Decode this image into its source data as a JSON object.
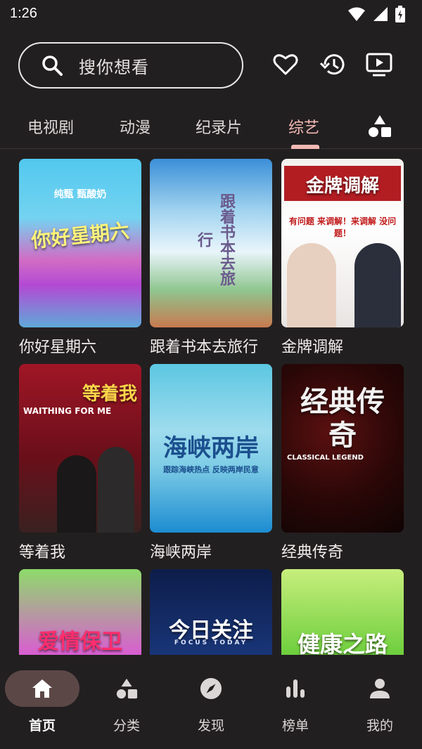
{
  "status_bar": {
    "time": "1:26"
  },
  "search": {
    "placeholder": "搜你想看"
  },
  "header_actions": [
    "heart-icon",
    "history-icon",
    "tv-icon"
  ],
  "tabs": [
    {
      "label": "电视剧",
      "active": false
    },
    {
      "label": "动漫",
      "active": false
    },
    {
      "label": "纪录片",
      "active": false
    },
    {
      "label": "综艺",
      "active": true
    }
  ],
  "accent_color": "#f3b9b4",
  "background_color": "#221f20",
  "shows": [
    {
      "title": "你好星期六",
      "poster_text": "你好星期六",
      "poster_sub": "纯甄 甄酸奶"
    },
    {
      "title": "跟着书本去旅行",
      "poster_text": "跟着书本去旅行",
      "poster_sub": ""
    },
    {
      "title": "金牌调解",
      "poster_text": "金牌调解",
      "poster_sub": "有问题 来调解！来调解 没问题！"
    },
    {
      "title": "等着我",
      "poster_text": "等着我",
      "poster_sub": "WAITHING FOR ME"
    },
    {
      "title": "海峡两岸",
      "poster_text": "海峡两岸",
      "poster_sub": "跟踪海峡热点 反映两岸民意"
    },
    {
      "title": "经典传奇",
      "poster_text": "经典传奇",
      "poster_sub": "CLASSICAL LEGEND"
    },
    {
      "title": "",
      "poster_text": "爱情保卫战",
      "poster_sub": ""
    },
    {
      "title": "",
      "poster_text": "今日关注",
      "poster_sub": "FOCUS TODAY"
    },
    {
      "title": "",
      "poster_text": "健康之路",
      "poster_sub": ""
    }
  ],
  "bottom_nav": [
    {
      "label": "首页",
      "icon": "home-icon",
      "active": true
    },
    {
      "label": "分类",
      "icon": "category-icon",
      "active": false
    },
    {
      "label": "发现",
      "icon": "compass-icon",
      "active": false
    },
    {
      "label": "榜单",
      "icon": "chart-icon",
      "active": false
    },
    {
      "label": "我的",
      "icon": "person-icon",
      "active": false
    }
  ]
}
